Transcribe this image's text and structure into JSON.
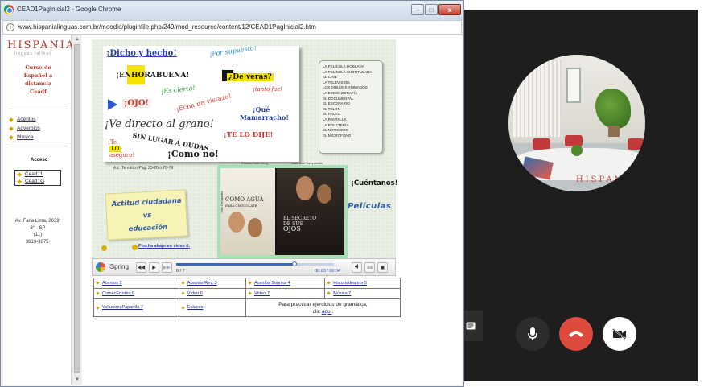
{
  "browser": {
    "window_title": "CEAD1PagInicial2 - Google Chrome",
    "url": "www.hispanialinguas.com.br/moodle/pluginfile.php/249/mod_resource/content/12/CEAD1PagInicial2.htm",
    "controls": {
      "minimize": "–",
      "maximize": "□",
      "close": "x"
    }
  },
  "sidebar": {
    "logo": "HISPANIA",
    "logo_registered": "®",
    "logo_sub": "linguas latinas",
    "course_lines": [
      "Curso de",
      "Español a",
      "distancia",
      "Ceadf"
    ],
    "links": [
      {
        "label": "Acentos"
      },
      {
        "label": "Adverbios"
      },
      {
        "label": "Música"
      }
    ],
    "acceso_title": "Acceso",
    "acceso_links": [
      {
        "label": "Cead11"
      },
      {
        "label": "Cead1G"
      }
    ],
    "address_lines": [
      "Av. Faria Lima, 2639,",
      "8° - SP",
      "(11)",
      "3813-3875."
    ]
  },
  "slide": {
    "phrases": {
      "dicho": "¡Dicho y hecho!",
      "supuesto": "¡Por supuesto!",
      "enhorabuena": "¡ENHORABUENA!",
      "deveras": "¿De veras?",
      "tanto_faz": "¡tanto faz!",
      "es_cierto": "¡Es cierto!",
      "ojo": "¡OJO!",
      "echa": "¡Echa un vistazo!",
      "que": "¡Qué",
      "mamarracho": "Mamarracho!",
      "ve_directo": "¡Ve directo al grano!",
      "te_lo_dije": "¡TE LO DIJE!",
      "sin_lugar": "SIN LUGAR A DUDAS",
      "te_lo_1": "¡Te",
      "te_lo_2": "LO",
      "te_lo_3": "aseguro!",
      "como_no": "¡Como no!"
    },
    "tv_list": [
      "LA PELÍCULA DOBLADA",
      "LA PELÍCULA SUBTITULADA",
      "EL CINE",
      "LA TELEVISIÓN",
      "LOS DIBUJOS ANIMADOS",
      "LA ESCENOGRAFÍA",
      "EL DOCUMENTAL",
      "EL ESCENARIO",
      "EL TELÓN",
      "EL PALCO",
      "LA PANTALLA",
      "LA BOLETERÍA",
      "EL NOTICIERO",
      "EL MICRÓFONO"
    ],
    "ref": "Voc. Temático Pág. 25-26 ó 78-79",
    "postit": [
      "Actitud ciudadana",
      "vs",
      "educación"
    ],
    "pincha": "Pincha abajo en vídeo 6.",
    "poster": {
      "top_left": "John Dellapietra",
      "top_mid": "Ricardo Darín Arrey",
      "top_right": "Juan José Campanella",
      "left_title": [
        "COMO AGUA",
        "PARA CHOCOLATE"
      ],
      "right_title": [
        "EL SECRETO",
        "DE SUS",
        "OJOS"
      ]
    },
    "cuentanos": "¡Cuéntanos!",
    "peliculas": "Películas"
  },
  "player": {
    "brand": "iSpring",
    "prev": "◀◀",
    "play": "▶",
    "next": "▶▶",
    "slide_counter": "6 / 7",
    "time": "00:03 / 00:04",
    "progress": 0.75,
    "volume_icon": "speaker-icon",
    "buttons_right": [
      "◀",
      "≡≡",
      "▣"
    ]
  },
  "links_table": {
    "row1": [
      "Acentos 2",
      "Acentos Rev. 3",
      "Acentos Sonrisa 4",
      "Historiadeamor 5"
    ],
    "row2": [
      "ComecErrores 6",
      "Vídeo 6",
      "Vídeo 7",
      "Música 7"
    ],
    "row3a": [
      "VoladoresPapantla 7",
      "Enlaces"
    ],
    "practica_text": "Para practicar ejercicios de gramática,",
    "practica_click": "clic",
    "practica_link": "aquí"
  },
  "call": {
    "watermark": "HISPANIA",
    "mic_label": "microphone-icon",
    "end_label": "end-call-icon",
    "cam_label": "camera-off-icon",
    "chat_label": "chat-icon"
  },
  "colors": {
    "brand_red": "#b3352b",
    "link_blue": "#1a2a8a",
    "end_call_red": "#dd4b3f",
    "call_bg": "#1e1e1e"
  }
}
